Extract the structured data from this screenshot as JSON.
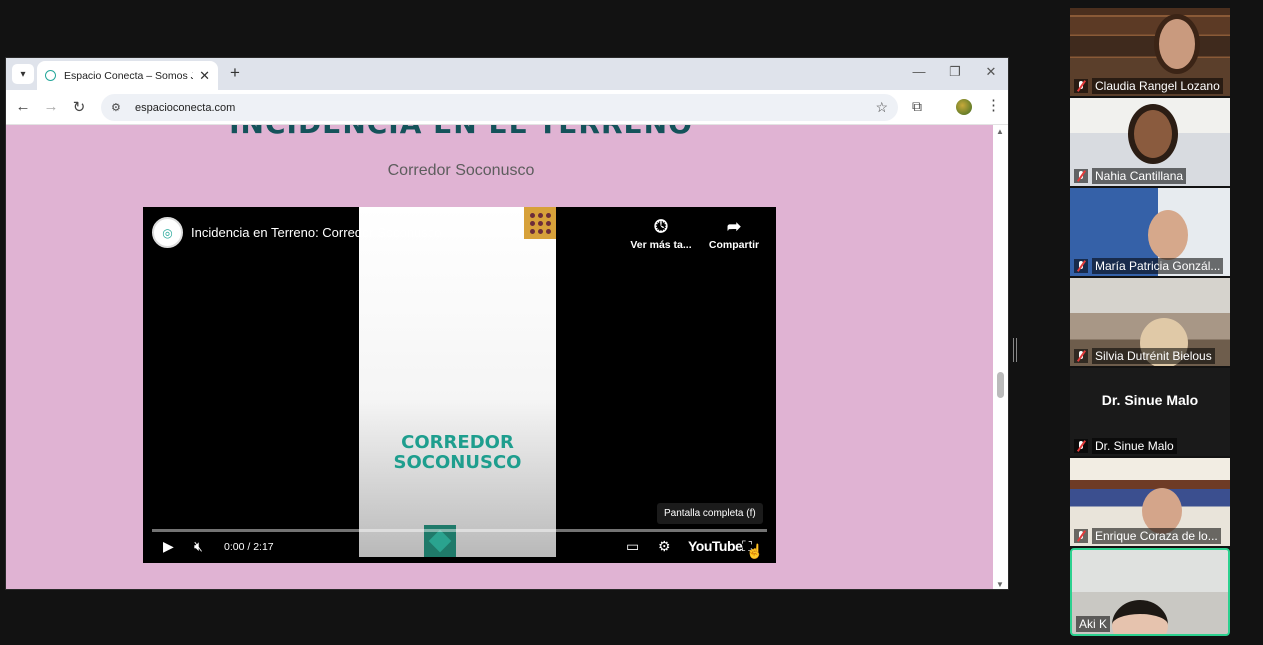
{
  "browser": {
    "tab_title": "Espacio Conecta – Somos Justicia",
    "url": "espacioconecta.com",
    "new_tab_icon": "+",
    "close_tab_icon": "✕"
  },
  "page": {
    "heading": "INCIDENCIA EN EL TERRENO",
    "subheading": "Corredor Soconusco"
  },
  "video": {
    "title": "Incidencia en Terreno: Corredor Soconusco",
    "thumb_text": "CORREDOR\nSOCONUSCO",
    "watch_later_label": "Ver más ta...",
    "share_label": "Compartir",
    "tooltip": "Pantalla completa (f)",
    "time": "0:00 / 2:17",
    "logo": "YouTube",
    "progress": 0
  },
  "participants": [
    {
      "name": "Claudia Rangel Lozano",
      "muted": true
    },
    {
      "name": "Nahia Cantillana",
      "muted": true
    },
    {
      "name": "María Patricia Gonzál...",
      "muted": true
    },
    {
      "name": "Silvia Dutrénit Bielous",
      "muted": true
    },
    {
      "name": "Dr. Sinue Malo",
      "big_name": "Dr. Sinue Malo",
      "muted": true
    },
    {
      "name": "Enrique Coraza de lo...",
      "muted": true
    },
    {
      "name": "Aki K",
      "muted": false,
      "active_speaker": true
    }
  ],
  "colors": {
    "page_bg": "#e0b3d3",
    "heading": "#14525a",
    "thumb_text": "#1e9e8e",
    "active_speaker_border": "#2cd18f",
    "muted_mic": "#e23b3b"
  }
}
